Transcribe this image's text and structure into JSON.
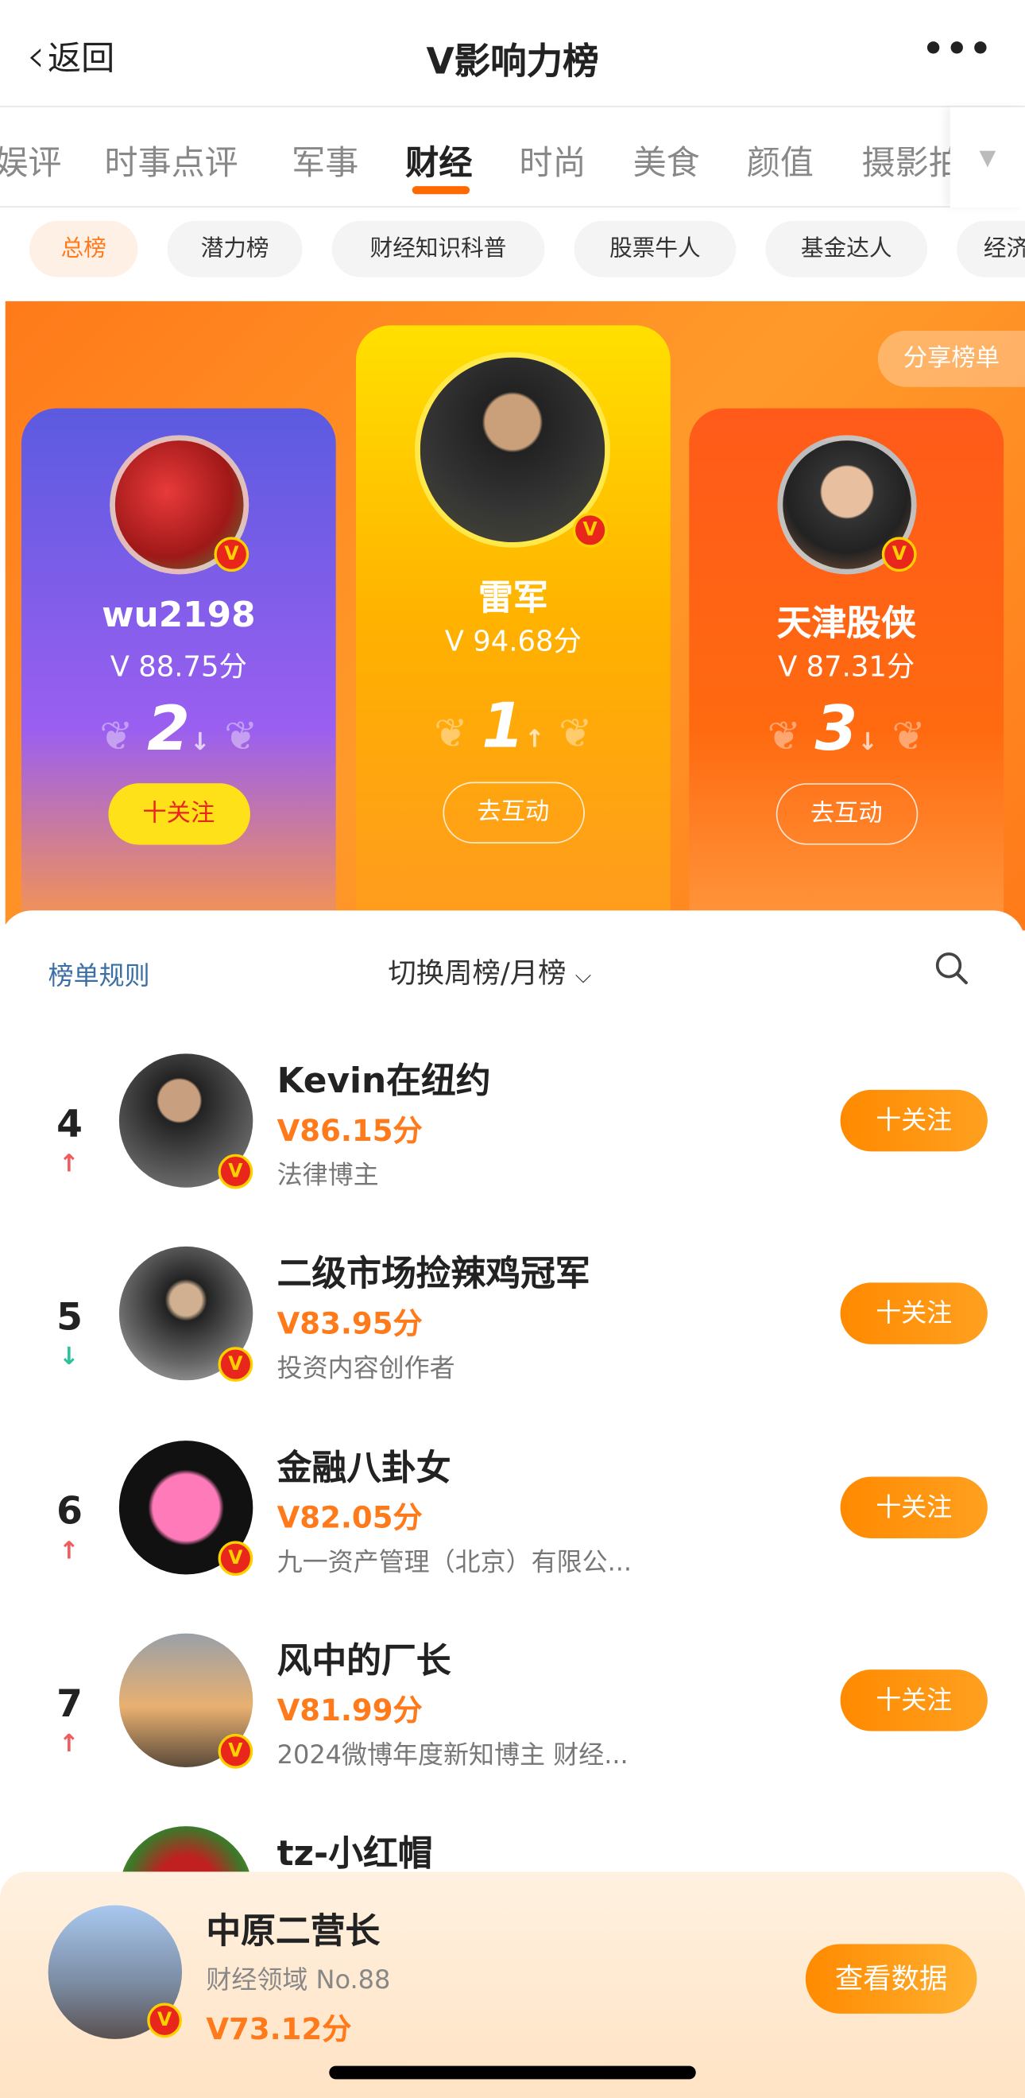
{
  "nav": {
    "back": "返回",
    "title": "V影响力榜",
    "more": "•••"
  },
  "tabs": [
    "娱评",
    "时事点评",
    "军事",
    "财经",
    "时尚",
    "美食",
    "颜值",
    "摄影拍"
  ],
  "chips": [
    "总榜",
    "潜力榜",
    "财经知识科普",
    "股票牛人",
    "基金达人",
    "经济"
  ],
  "share": "分享榜单",
  "podium": [
    {
      "name": "wu2198",
      "score": "88.75分",
      "rank": "2",
      "trend": "down",
      "button": "十关注"
    },
    {
      "name": "雷军",
      "score": "94.68分",
      "rank": "1",
      "trend": "up",
      "button": "去互动"
    },
    {
      "name": "天津股侠",
      "score": "87.31分",
      "rank": "3",
      "trend": "down",
      "button": "去互动"
    }
  ],
  "list_header": {
    "rules": "榜单规则",
    "switch": "切换周榜/月榜"
  },
  "rows": [
    {
      "rank": "4",
      "trend": "↑",
      "name": "Kevin在纽约",
      "score": "86.15分",
      "desc": "法律博主",
      "button": "十关注"
    },
    {
      "rank": "5",
      "trend": "↓",
      "name": "二级市场捡辣鸡冠军",
      "score": "83.95分",
      "desc": "投资内容创作者",
      "button": "十关注"
    },
    {
      "rank": "6",
      "trend": "↑",
      "name": "金融八卦女",
      "score": "82.05分",
      "desc": "九一资产管理（北京）有限公...",
      "button": "十关注"
    },
    {
      "rank": "7",
      "trend": "↑",
      "name": "风中的厂长",
      "score": "81.99分",
      "desc": "2024微博年度新知博主 财经...",
      "button": "十关注"
    },
    {
      "rank": "",
      "trend": "",
      "name": "tz-小红帽",
      "score": "",
      "desc": "",
      "button": ""
    }
  ],
  "me": {
    "name": "中原二营长",
    "domain": "财经领域 No.88",
    "score": "73.12分",
    "button": "查看数据"
  },
  "colors": {
    "accent": "#ff7a1a",
    "up": "#f25b5b",
    "down": "#2bc29b"
  }
}
